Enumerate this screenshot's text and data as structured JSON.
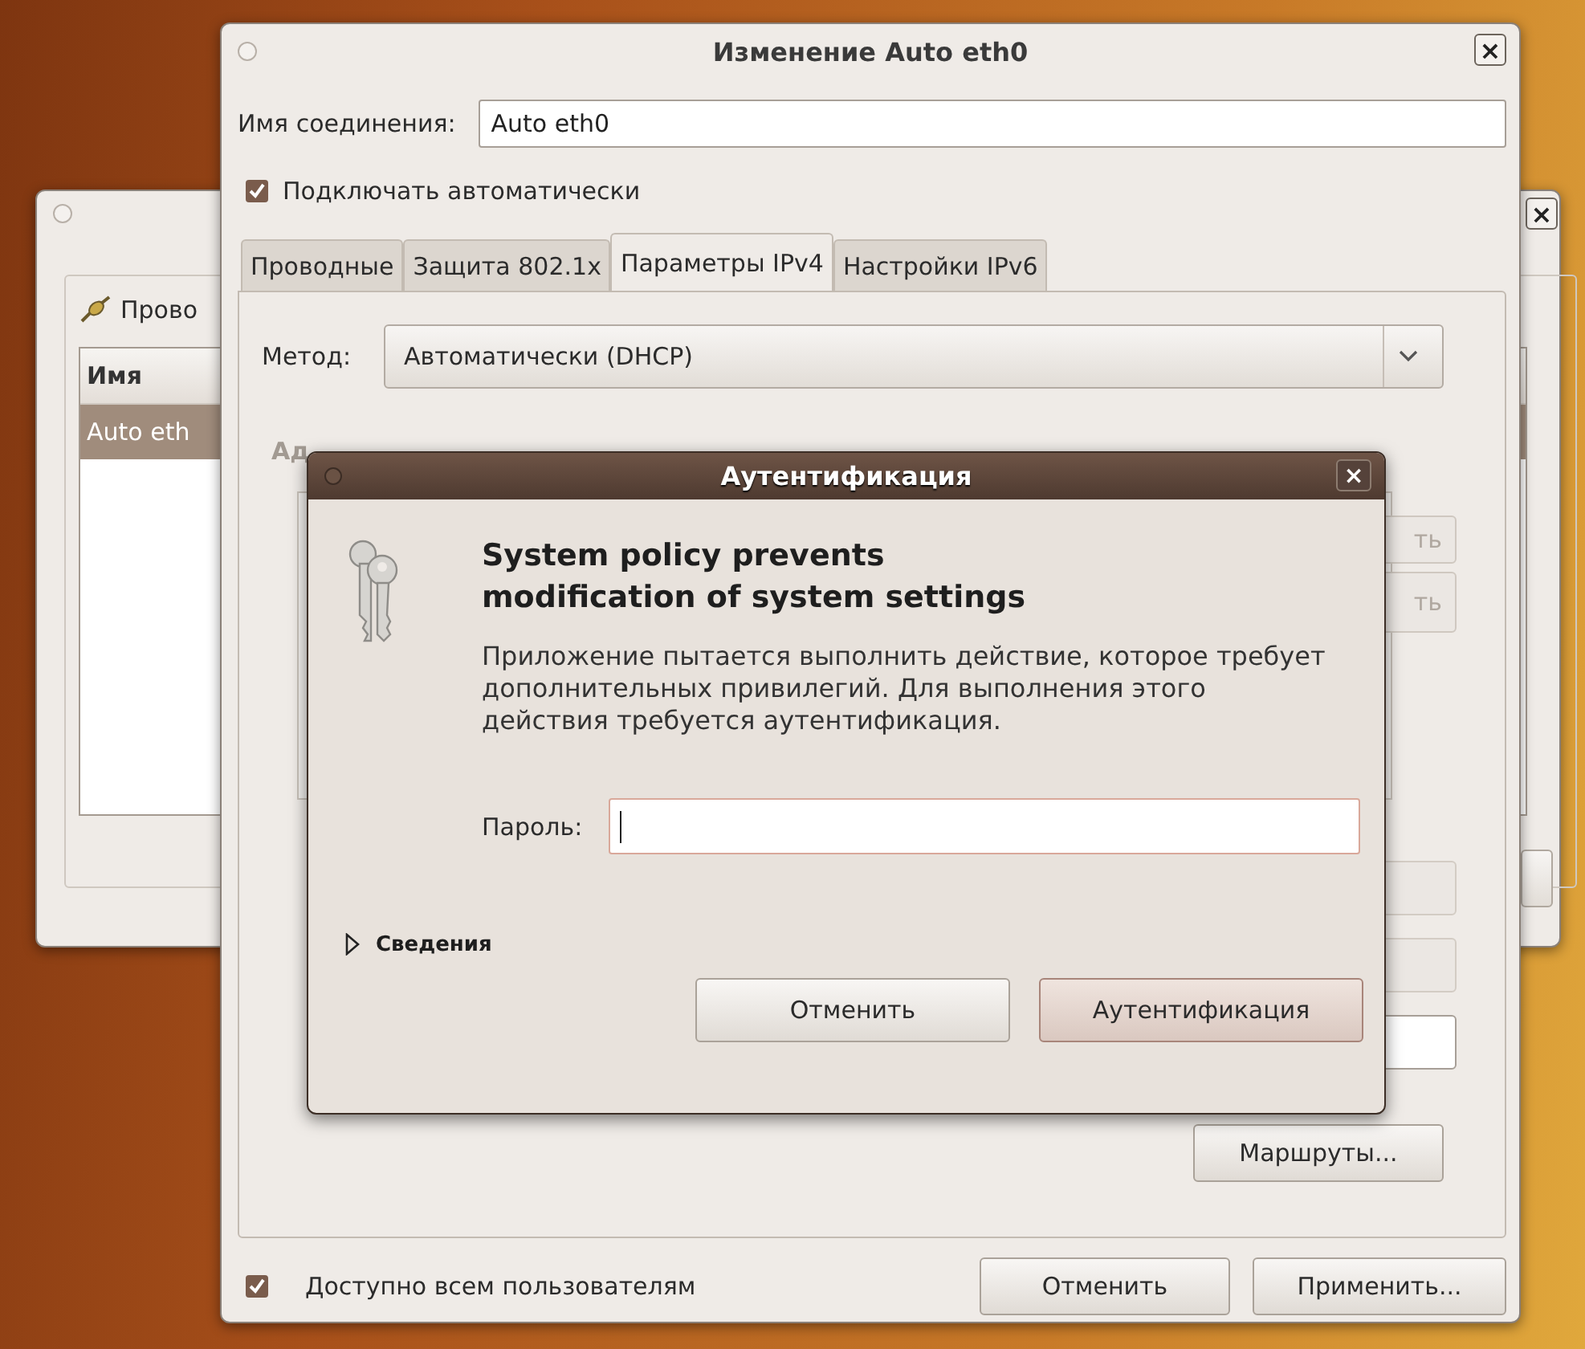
{
  "back_window": {
    "close": "×",
    "section_title": "Прово",
    "list": {
      "column": "Имя",
      "rows": [
        {
          "text": "Auto eth",
          "selected": true
        }
      ]
    }
  },
  "main_window": {
    "title": "Изменение Auto eth0",
    "close": "×",
    "connection_name": {
      "label": "Имя соединения:",
      "value": "Auto eth0"
    },
    "auto_connect": {
      "label": "Подключать автоматически",
      "checked": true
    },
    "tabs": [
      {
        "label": "Проводные",
        "selected": false
      },
      {
        "label": "Защита 802.1x",
        "selected": false
      },
      {
        "label": "Параметры IPv4",
        "selected": true
      },
      {
        "label": "Настройки IPv6",
        "selected": false
      }
    ],
    "method": {
      "label": "Метод:",
      "value": "Автоматически (DHCP)"
    },
    "obscured": {
      "heading": "Ад",
      "buttons": [
        "ть",
        "ть"
      ]
    },
    "routes_button": {
      "label": "Маршруты..."
    },
    "all_users": {
      "label": "Доступно всем пользователям",
      "checked": true
    },
    "buttons": [
      {
        "label": "Отменить"
      },
      {
        "label": "Применить..."
      }
    ]
  },
  "auth_dialog": {
    "title": "Аутентификация",
    "close": "×",
    "heading": "System policy prevents modification of system settings",
    "message": "Приложение пытается выполнить действие, которое требует дополнительных привилегий. Для выполнения этого действия требуется аутентификация.",
    "password": {
      "label": "Пароль:"
    },
    "details": {
      "label": "Сведения",
      "expanded": false
    },
    "buttons": [
      {
        "label": "Отменить",
        "default": false
      },
      {
        "label": "Аутентификация",
        "default": true
      }
    ]
  }
}
